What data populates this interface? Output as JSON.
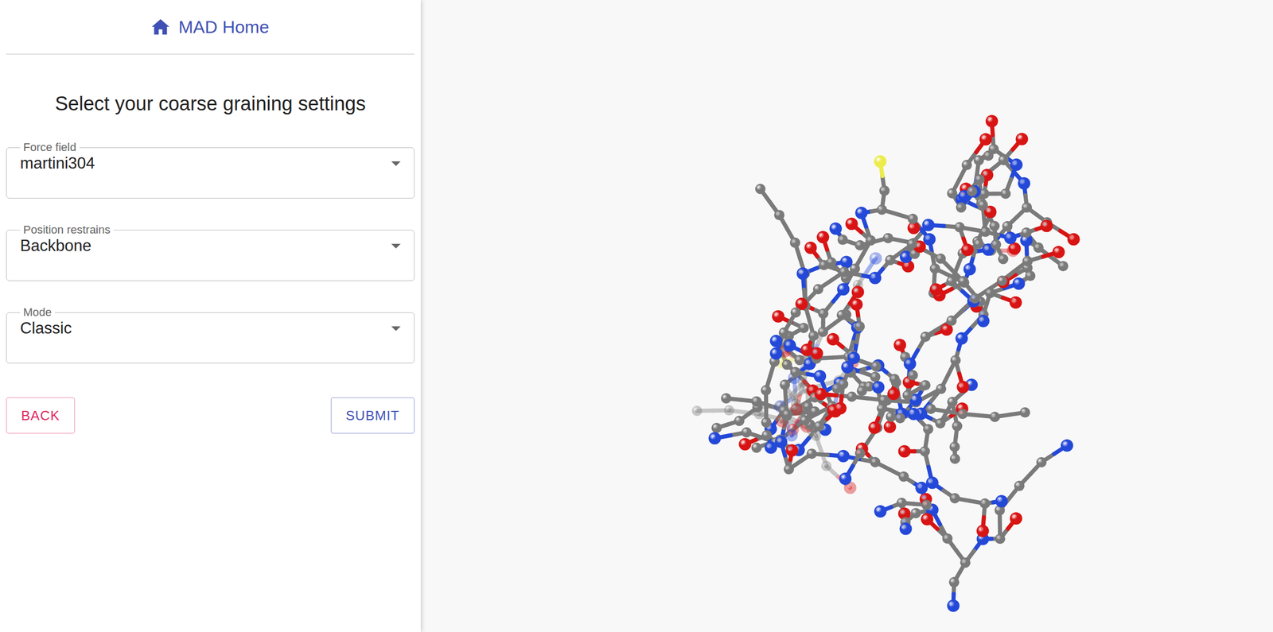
{
  "header": {
    "home_link": "MAD Home"
  },
  "title": "Select your coarse graining settings",
  "fields": [
    {
      "label": "Force field",
      "value": "martini304"
    },
    {
      "label": "Position restrains",
      "value": "Backbone"
    },
    {
      "label": "Mode",
      "value": "Classic"
    }
  ],
  "buttons": [
    {
      "label": "BACK",
      "kind": "secondary"
    },
    {
      "label": "SUBMIT",
      "kind": "primary"
    }
  ]
}
